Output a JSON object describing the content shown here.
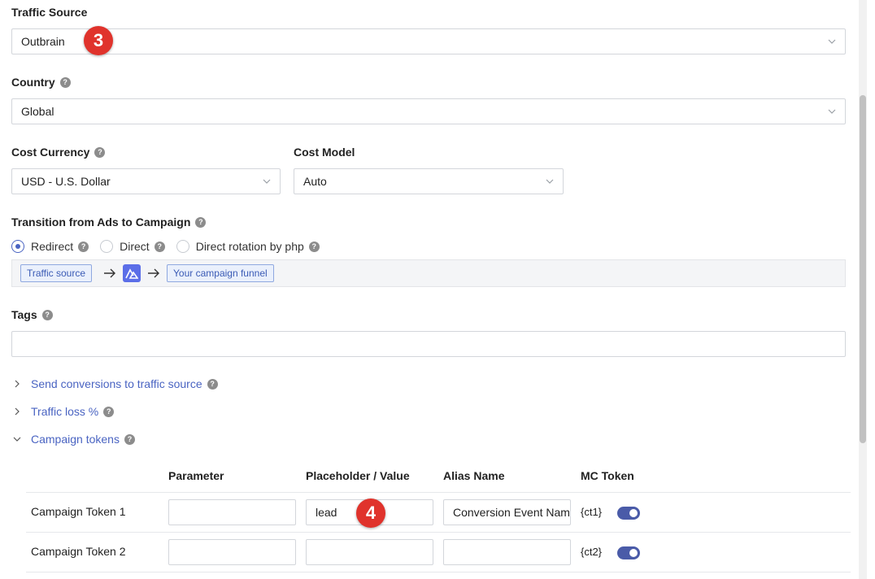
{
  "traffic_source": {
    "label": "Traffic Source",
    "value": "Outbrain"
  },
  "country": {
    "label": "Country",
    "value": "Global"
  },
  "cost_currency": {
    "label": "Cost Currency",
    "value": "USD - U.S. Dollar"
  },
  "cost_model": {
    "label": "Cost Model",
    "value": "Auto"
  },
  "transition": {
    "label": "Transition from Ads to Campaign",
    "options": [
      "Redirect",
      "Direct",
      "Direct rotation by php"
    ],
    "selected": "Redirect",
    "flow": {
      "source": "Traffic source",
      "target": "Your campaign funnel"
    }
  },
  "tags": {
    "label": "Tags",
    "value": ""
  },
  "sections": {
    "send_conversions": "Send conversions to traffic source",
    "traffic_loss": "Traffic loss %",
    "campaign_tokens": "Campaign tokens"
  },
  "tokens_table": {
    "headers": [
      "Parameter",
      "Placeholder / Value",
      "Alias Name",
      "MC Token"
    ],
    "rows": [
      {
        "name": "Campaign Token 1",
        "parameter": "",
        "placeholder": "lead",
        "alias": "Conversion Event Name",
        "mc_token": "{ct1}",
        "enabled": true
      },
      {
        "name": "Campaign Token 2",
        "parameter": "",
        "placeholder": "",
        "alias": "",
        "mc_token": "{ct2}",
        "enabled": true
      }
    ]
  },
  "annotations": [
    "3",
    "4"
  ],
  "colors": {
    "accent": "#4a64c2",
    "badge": "#e0332c",
    "toggle": "#4a5ba8"
  }
}
